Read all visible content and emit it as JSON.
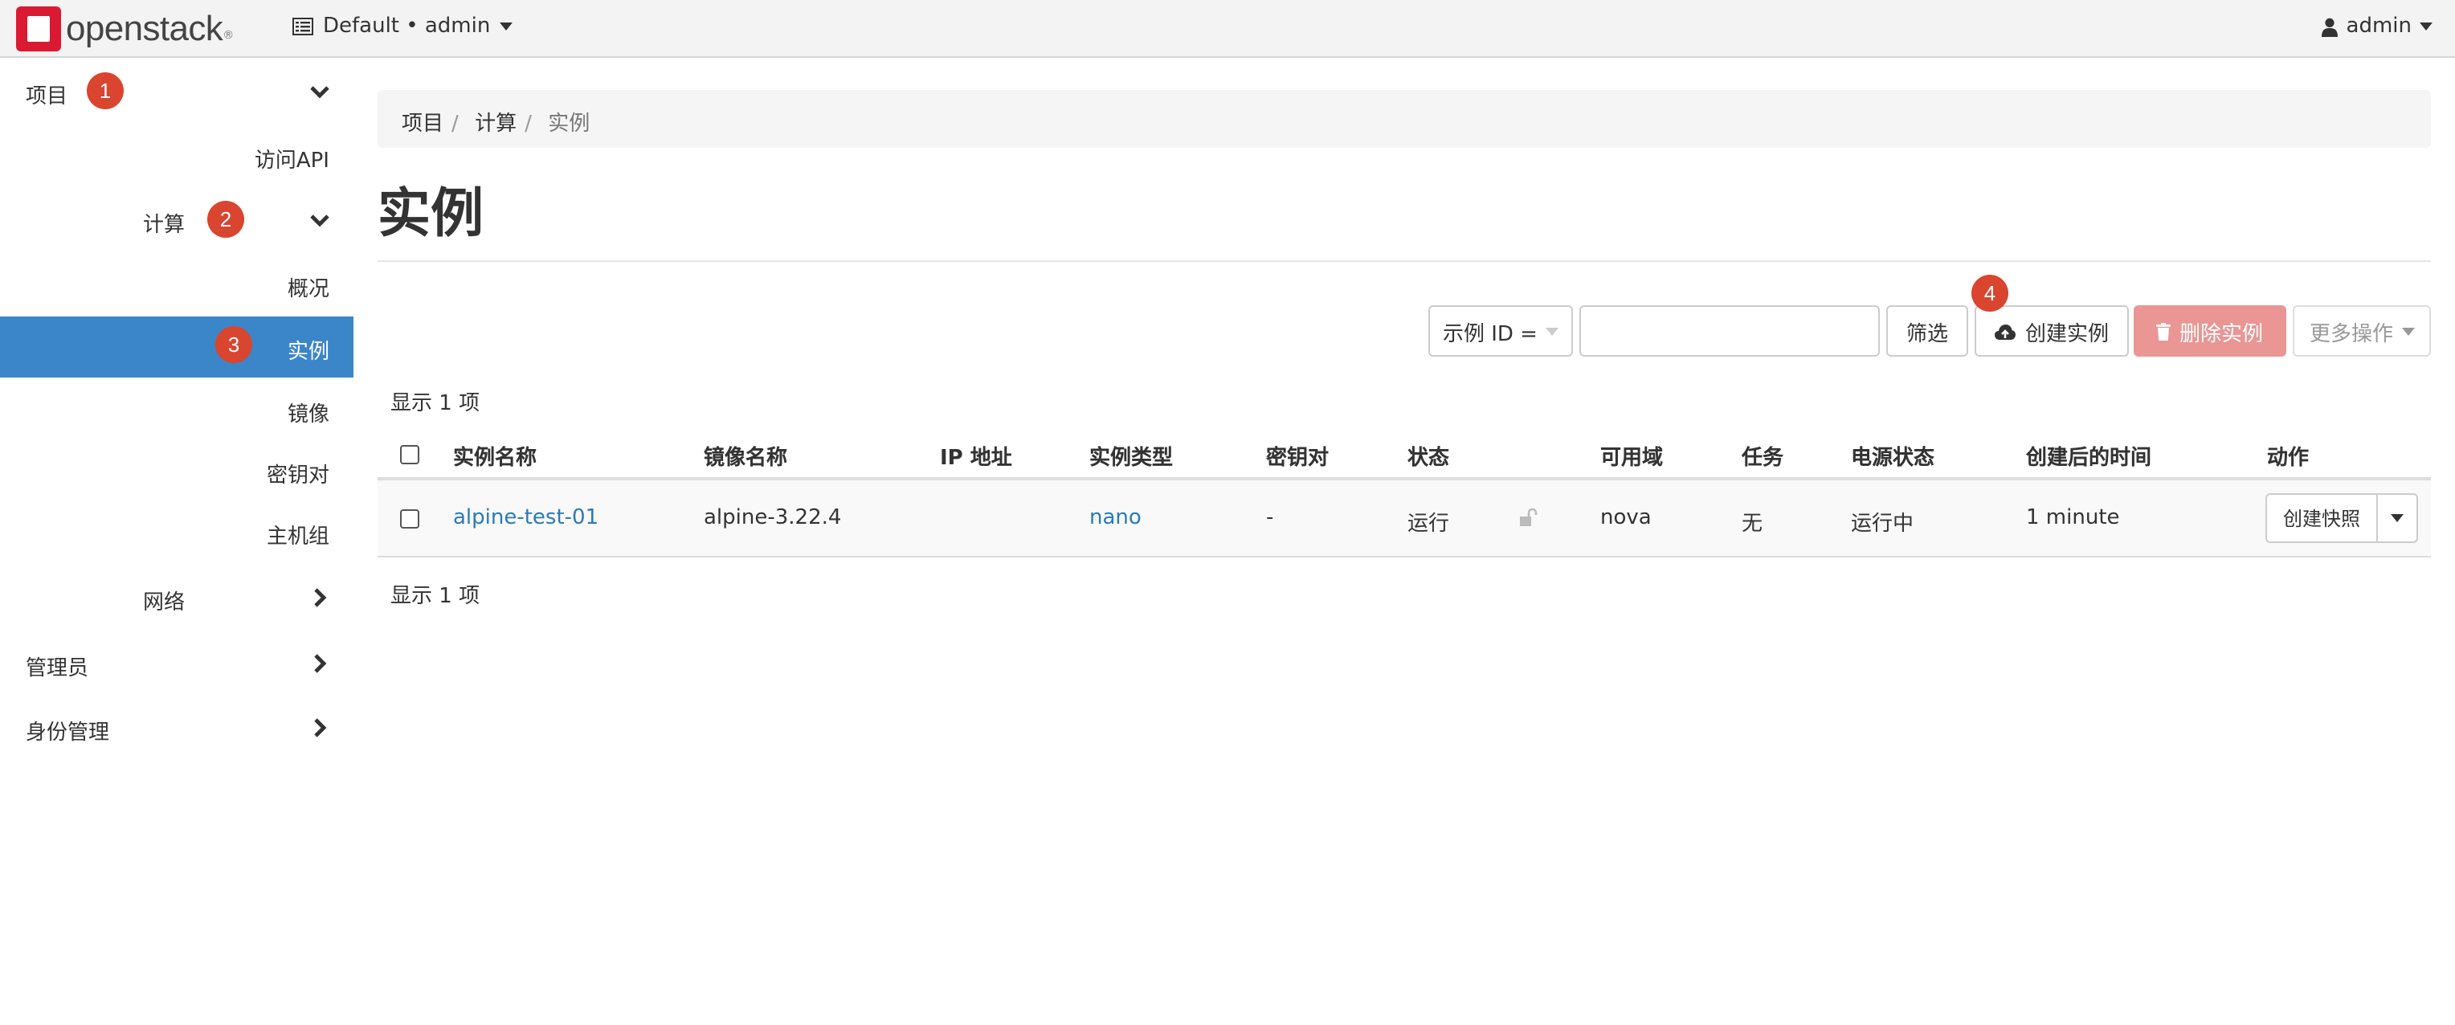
{
  "brand": {
    "name": "openstack",
    "registered": "®"
  },
  "topbar": {
    "project_selector": "Default • admin",
    "user": "admin"
  },
  "sidebar": {
    "project": "项目",
    "api_access": "访问API",
    "compute": "计算",
    "overview": "概况",
    "instances": "实例",
    "images": "镜像",
    "key_pairs": "密钥对",
    "server_groups": "主机组",
    "network": "网络",
    "admin": "管理员",
    "identity": "身份管理"
  },
  "annotations": [
    "1",
    "2",
    "3",
    "4"
  ],
  "breadcrumb": [
    "项目",
    "计算",
    "实例"
  ],
  "page_title": "实例",
  "toolbar": {
    "filter_field": "示例 ID =",
    "filter_value": "",
    "filter_button": "筛选",
    "launch_button": "创建实例",
    "delete_button": "删除实例",
    "more_actions": "更多操作"
  },
  "count_text": "显示 1 项",
  "table": {
    "headers": [
      "实例名称",
      "镜像名称",
      "IP 地址",
      "实例类型",
      "密钥对",
      "状态",
      "可用域",
      "任务",
      "电源状态",
      "创建后的时间",
      "动作"
    ],
    "rows": [
      {
        "name": "alpine-test-01",
        "image": "alpine-3.22.4",
        "ip": "",
        "flavor": "nano",
        "key_pair": "-",
        "status": "运行",
        "zone": "nova",
        "task": "无",
        "power": "运行中",
        "age": "1 minute",
        "action": "创建快照"
      }
    ]
  },
  "colors": {
    "active": "#3b86c8",
    "badge": "#d9452f",
    "danger": "#e99694",
    "link": "#2a7ab8"
  }
}
